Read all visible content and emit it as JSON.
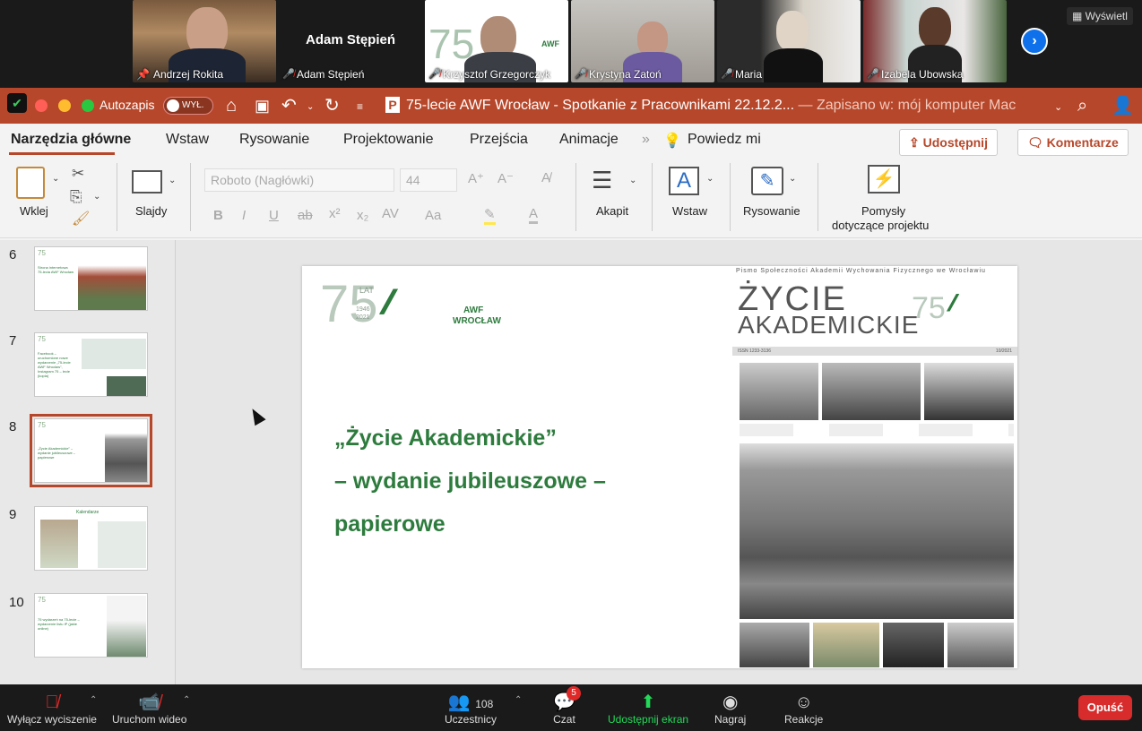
{
  "participants": [
    {
      "name": "Andrzej Rokita",
      "muted": false,
      "pinned": true
    },
    {
      "name": "Adam Stępień",
      "muted": true,
      "video": false
    },
    {
      "name": "Krzysztof Grzegorczyk",
      "muted": true
    },
    {
      "name": "Krystyna Zatoń",
      "muted": true
    },
    {
      "name": "Maria",
      "muted": true
    },
    {
      "name": "Izabela Ubowska",
      "muted": true
    }
  ],
  "view_button": "Wyświetl",
  "ppt": {
    "autosave_label": "Autozapis",
    "autosave_state": "WYŁ.",
    "doc_title": "75-lecie AWF Wrocław - Spotkanie z Pracownikami 22.12.2...",
    "saved_status": "— Zapisano w: mój komputer Mac",
    "tabs": [
      "Narzędzia główne",
      "Wstaw",
      "Rysowanie",
      "Projektowanie",
      "Przejścia",
      "Animacje"
    ],
    "tell_me": "Powiedz mi",
    "share": "Udostępnij",
    "comments": "Komentarze",
    "ribbon": {
      "paste": "Wklej",
      "slides": "Slajdy",
      "font_name": "Roboto (Nagłówki)",
      "font_size": "44",
      "paragraph": "Akapit",
      "insert": "Wstaw",
      "drawing": "Rysowanie",
      "ideas_line1": "Pomysły",
      "ideas_line2": "dotyczące projektu"
    },
    "slide_numbers": [
      "6",
      "7",
      "8",
      "9",
      "10"
    ],
    "selected_slide": "8",
    "thumb_texts": {
      "t6": "Strona internetowa 75-lecia AWF Wrocław",
      "t7": "Facebook – uruchomione nowe wydarzenie „75-lecie AWF Wrocław”, Instagram 75 – lecie (kopia)",
      "t8": "„Życie Akademickie” – wydanie jubileuszowe – papierowe",
      "t9": "Kalendarze",
      "t10": "75 wydarzeń na 75-lecie – wydarzenie listu IP (jakie online)"
    },
    "slide": {
      "line1": "„Życie Akademickie”",
      "line2": "– wydanie jubileuszowe –",
      "line3": "papierowe",
      "logo_lat": "LAT",
      "logo_years": "1946 2021",
      "logo_awf": "AWF",
      "logo_city": "WROCŁAW",
      "mag_header": "Pismo Społeczności Akademii Wychowania Fizycznego we Wrocławiu",
      "mag_title1": "ŻYCIE",
      "mag_title2": "AKADEMICKIE",
      "mag_issn": "ISSN 1233-3136",
      "mag_issue": "10/2021"
    }
  },
  "zoom_bar": {
    "mute": "Wyłącz wyciszenie",
    "video": "Uruchom wideo",
    "participants": "Uczestnicy",
    "participants_count": "108",
    "chat": "Czat",
    "chat_badge": "5",
    "share": "Udostępnij ekran",
    "record": "Nagraj",
    "reactions": "Reakcje",
    "leave": "Opuść"
  },
  "colors": {
    "ppt_accent": "#b7472a",
    "awf_green": "#2d7b3d",
    "zoom_bg": "#1a1a1a",
    "share_green": "#23d959",
    "leave_red": "#d82b2b"
  }
}
